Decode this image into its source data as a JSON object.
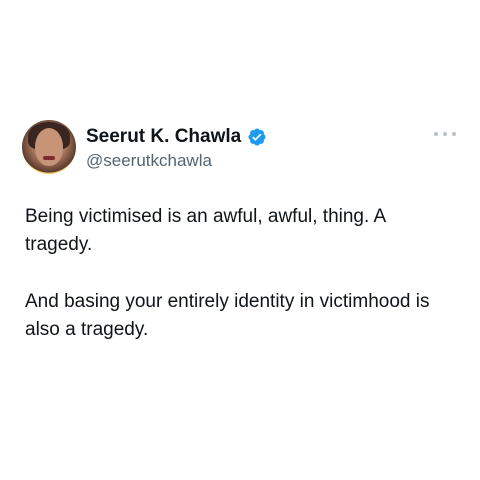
{
  "author": {
    "display_name": "Seerut K. Chawla",
    "handle": "@seerutkchawla",
    "verified_icon": "verified-badge-icon",
    "avatar_icon": "avatar"
  },
  "actions": {
    "more_icon": "more-options-icon"
  },
  "tweet": {
    "paragraph_1": "Being victimised is an awful, awful, thing. A tragedy.",
    "paragraph_2": "And basing your entirely identity in victimhood is also a tragedy."
  },
  "colors": {
    "text_primary": "#0f1419",
    "text_secondary": "#536471",
    "verified_blue": "#1d9bf0",
    "background": "#ffffff"
  }
}
